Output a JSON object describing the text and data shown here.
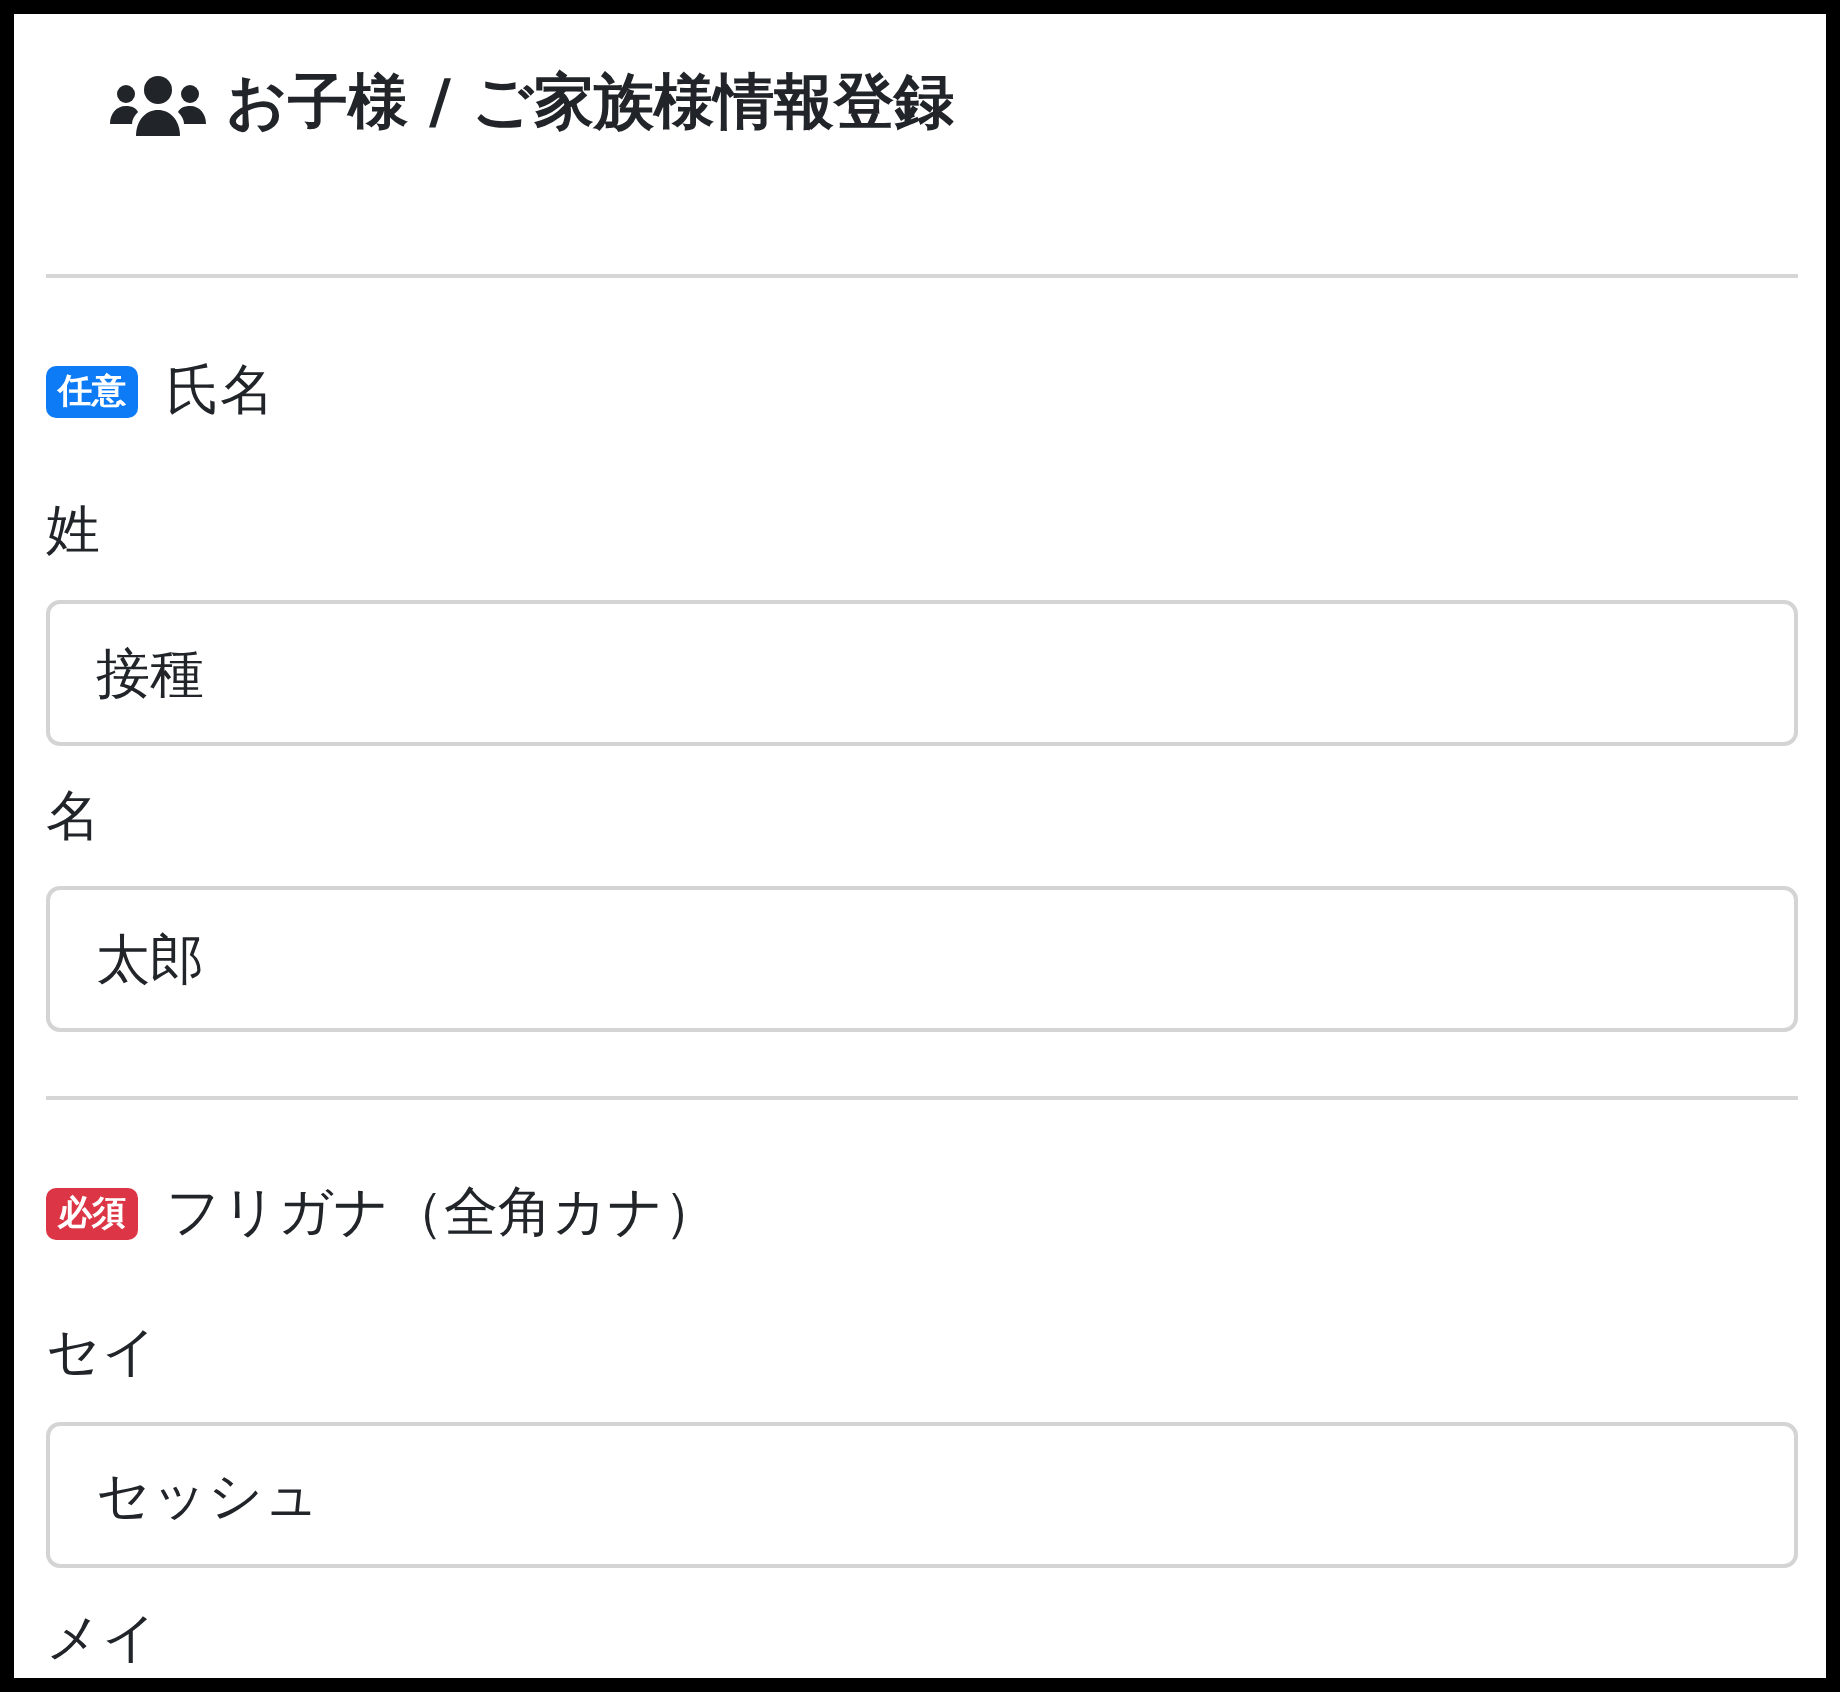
{
  "title": "お子様 / ご家族様情報登録",
  "sections": [
    {
      "badge": "任意",
      "required": false,
      "label": "氏名",
      "fields": [
        {
          "label": "姓",
          "value": "接種"
        },
        {
          "label": "名",
          "value": "太郎"
        }
      ]
    },
    {
      "badge": "必須",
      "required": true,
      "label": "フリガナ（全角カナ）",
      "fields": [
        {
          "label": "セイ",
          "value": "セッシュ"
        },
        {
          "label": "メイ"
        }
      ]
    }
  ]
}
